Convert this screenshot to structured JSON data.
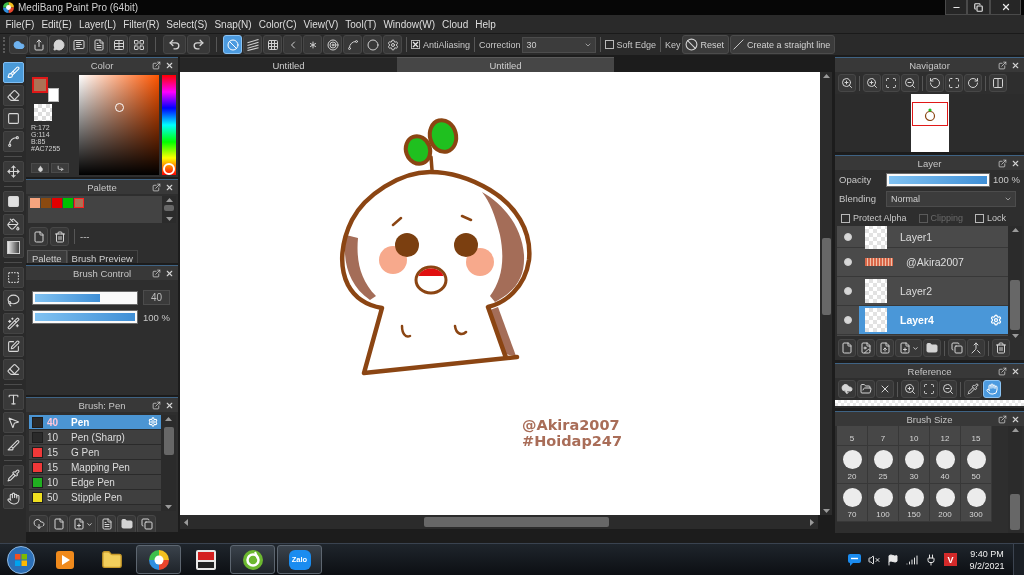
{
  "window": {
    "title": "MediBang Paint Pro (64bit)"
  },
  "menu": [
    "File(F)",
    "Edit(E)",
    "Layer(L)",
    "Filter(R)",
    "Select(S)",
    "Snap(N)",
    "Color(C)",
    "View(V)",
    "Tool(T)",
    "Window(W)",
    "Cloud",
    "Help"
  ],
  "toolbar": {
    "snaps": [
      {
        "kind": "off",
        "selected": true
      },
      {
        "kind": "parallel",
        "selected": false
      },
      {
        "kind": "grid",
        "selected": false
      },
      {
        "kind": "perspective",
        "selected": false
      },
      {
        "kind": "radial",
        "selected": false
      },
      {
        "kind": "concentric",
        "selected": false
      },
      {
        "kind": "curve",
        "selected": false
      },
      {
        "kind": "circle",
        "selected": false
      }
    ],
    "antialiasing": {
      "label": "AntiAliasing",
      "checked": true
    },
    "correction": {
      "label": "Correction",
      "value": "30"
    },
    "soft_edge": {
      "label": "Soft Edge",
      "checked": false
    },
    "key_label": "Key",
    "reset_button": "Reset",
    "straight_line_button": "Create a straight line"
  },
  "tools": [
    [
      {
        "kind": "brush",
        "selected": true
      },
      {
        "kind": "eraser",
        "selected": false
      },
      {
        "kind": "dot",
        "selected": false
      },
      {
        "kind": "vector",
        "selected": false
      }
    ],
    [
      {
        "kind": "move",
        "selected": false
      }
    ],
    [
      {
        "kind": "fill",
        "selected": false
      },
      {
        "kind": "bucket",
        "selected": false
      },
      {
        "kind": "gradient",
        "selected": false
      }
    ],
    [
      {
        "kind": "select",
        "selected": false
      },
      {
        "kind": "lasso",
        "selected": false
      },
      {
        "kind": "wand",
        "selected": false
      },
      {
        "kind": "select_pen",
        "selected": false
      },
      {
        "kind": "select_eraser",
        "selected": false
      }
    ],
    [
      {
        "kind": "text",
        "selected": false
      },
      {
        "kind": "operation",
        "selected": false
      },
      {
        "kind": "divide",
        "selected": false
      }
    ],
    [
      {
        "kind": "eyedropper",
        "selected": false
      },
      {
        "kind": "hand",
        "selected": false
      }
    ]
  ],
  "color_panel": {
    "title": "Color",
    "readout": [
      "R:172",
      "G:114",
      "B:85"
    ],
    "hex": "#AC7255",
    "hue_slider": {
      "level": 0.06
    }
  },
  "palette_panel": {
    "title": "Palette",
    "swatches": [
      {
        "color": "#f6a47e",
        "selected": false
      },
      {
        "color": "#8b4a10",
        "selected": false
      },
      {
        "color": "#e40000",
        "selected": false
      },
      {
        "color": "#00c000",
        "selected": false
      },
      {
        "color": "#ac7255",
        "selected": true
      }
    ],
    "name": "---",
    "tabs": [
      {
        "label": "Palette",
        "selected": true
      },
      {
        "label": "Brush Preview",
        "selected": false
      }
    ]
  },
  "brush_control": {
    "title": "Brush Control",
    "size": {
      "level": 0.65,
      "reading": "40"
    },
    "opacity": {
      "level": 1,
      "reading": "100 %"
    }
  },
  "brush_list": {
    "title": "Brush: Pen",
    "items": [
      {
        "size": "40",
        "name": "Pen",
        "color": "#2a2a2a",
        "selected": true
      },
      {
        "size": "10",
        "name": "Pen (Sharp)",
        "color": "#2a2a2a",
        "selected": false
      },
      {
        "size": "15",
        "name": "G Pen",
        "color": "#f03838",
        "selected": false
      },
      {
        "size": "15",
        "name": "Mapping Pen",
        "color": "#f03838",
        "selected": false
      },
      {
        "size": "10",
        "name": "Edge Pen",
        "color": "#20b020",
        "selected": false
      },
      {
        "size": "50",
        "name": "Stipple Pen",
        "color": "#f0e020",
        "selected": false
      }
    ]
  },
  "document_tabs": [
    {
      "label": "Untitled",
      "selected": false
    },
    {
      "label": "Untitled",
      "selected": true
    }
  ],
  "canvas": {
    "signature": [
      "@Akira2007",
      "#Hoidap247"
    ]
  },
  "navigator": {
    "title": "Navigator"
  },
  "layer_panel": {
    "title": "Layer",
    "opacity": {
      "label": "Opacity",
      "level": 1,
      "reading": "100 %"
    },
    "blending": {
      "label": "Blending",
      "value": "Normal"
    },
    "options": [
      {
        "label": "Protect Alpha",
        "checked": false,
        "disabled": false
      },
      {
        "label": "Clipping",
        "checked": false,
        "disabled": true
      },
      {
        "label": "Lock",
        "checked": false,
        "disabled": false
      }
    ],
    "layers": [
      {
        "name": "Layer1",
        "kind": "empty",
        "visible": true,
        "selected": false
      },
      {
        "name": "@Akira2007",
        "kind": "text",
        "visible": true,
        "selected": false
      },
      {
        "name": "Layer2",
        "kind": "empty",
        "visible": true,
        "selected": false
      },
      {
        "name": "Layer4",
        "kind": "empty",
        "visible": true,
        "selected": true
      }
    ]
  },
  "reference_panel": {
    "title": "Reference",
    "tools": [
      [
        {
          "kind": "cloud_download",
          "selected": false
        },
        {
          "kind": "folder",
          "selected": false
        },
        {
          "kind": "close",
          "selected": false
        }
      ],
      [
        {
          "kind": "zoom_in",
          "selected": false
        },
        {
          "kind": "fit",
          "selected": false
        },
        {
          "kind": "zoom_out",
          "selected": false
        }
      ],
      [
        {
          "kind": "eyedropper",
          "selected": false
        },
        {
          "kind": "hand",
          "selected": true
        }
      ]
    ]
  },
  "brush_size_panel": {
    "title": "Brush Size",
    "sizes": [
      {
        "label": "5",
        "dot_shown": false
      },
      {
        "label": "7",
        "dot_shown": false
      },
      {
        "label": "10",
        "dot_shown": false
      },
      {
        "label": "12",
        "dot_shown": false
      },
      {
        "label": "15",
        "dot_shown": false
      },
      {
        "label": "20",
        "dot_shown": true
      },
      {
        "label": "25",
        "dot_shown": true
      },
      {
        "label": "30",
        "dot_shown": true
      },
      {
        "label": "40",
        "dot_shown": true
      },
      {
        "label": "50",
        "dot_shown": true
      },
      {
        "label": "70",
        "dot_shown": true
      },
      {
        "label": "100",
        "dot_shown": true
      },
      {
        "label": "150",
        "dot_shown": true
      },
      {
        "label": "200",
        "dot_shown": true
      },
      {
        "label": "300",
        "dot_shown": true
      }
    ]
  },
  "taskbar": {
    "apps": [
      {
        "kind": "media",
        "running": false
      },
      {
        "kind": "folder",
        "running": false
      },
      {
        "kind": "medibang",
        "running": true
      },
      {
        "kind": "paint",
        "running": false
      },
      {
        "kind": "ring",
        "running": true
      },
      {
        "kind": "zalo",
        "running": true,
        "logo_text": "Zalo"
      }
    ],
    "tray_letter": "V",
    "time": "9:40 PM",
    "date": "9/2/2021"
  }
}
